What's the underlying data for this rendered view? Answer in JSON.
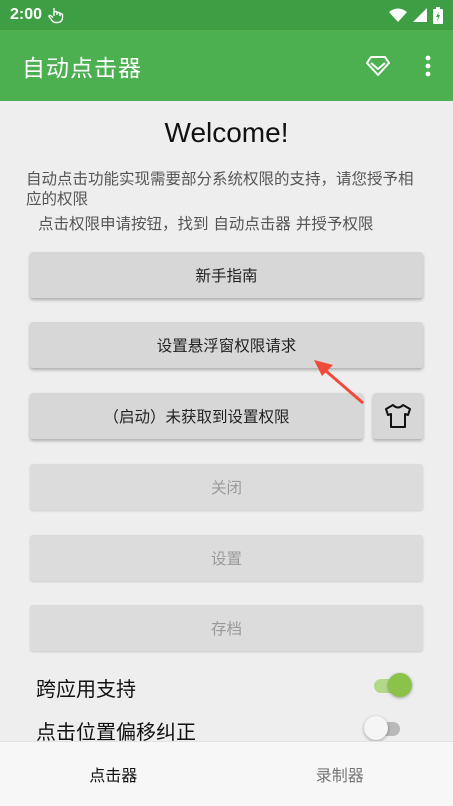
{
  "status_bar": {
    "time": "2:00"
  },
  "toolbar": {
    "title": "自动点击器"
  },
  "main": {
    "welcome": "Welcome!",
    "description": "自动点击功能实现需要部分系统权限的支持，请您授予相应的权限",
    "instruction": "点击权限申请按钮，找到 自动点击器 并授予权限",
    "buttons": {
      "guide": "新手指南",
      "overlay_permission": "设置悬浮窗权限请求",
      "start": "（启动）未获取到设置权限",
      "close": "关闭",
      "settings": "设置",
      "save": "存档"
    },
    "toggles": [
      {
        "label": "跨应用支持",
        "on": true
      },
      {
        "label": "点击位置偏移纠正",
        "on": false
      }
    ]
  },
  "bottom_nav": {
    "tabs": [
      {
        "label": "点击器",
        "active": true
      },
      {
        "label": "录制器",
        "active": false
      }
    ]
  },
  "colors": {
    "status_bar": "#3D9E43",
    "toolbar": "#4CAF50",
    "switch_on": "#8BC34A",
    "annotation_arrow": "#F04A3A"
  },
  "icons": [
    "hand-pointer-icon",
    "wifi-icon",
    "signal-icon",
    "battery-icon",
    "diamond-icon",
    "overflow-menu-icon",
    "shirt-icon"
  ]
}
